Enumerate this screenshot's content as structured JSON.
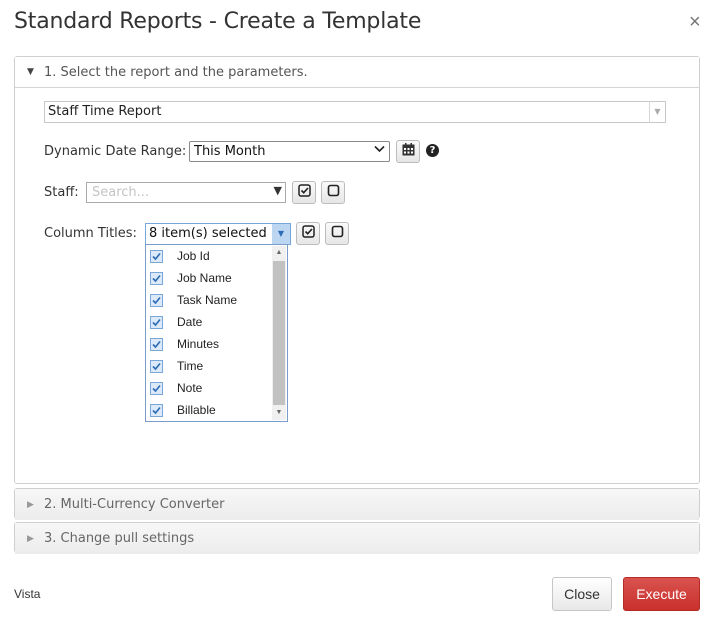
{
  "dialog": {
    "title": "Standard Reports - Create a Template",
    "close_glyph": "×"
  },
  "panels": [
    {
      "label": "1. Select the report and the parameters.",
      "expanded": true
    },
    {
      "label": "2. Multi-Currency Converter",
      "expanded": false
    },
    {
      "label": "3. Change pull settings",
      "expanded": false
    }
  ],
  "report": {
    "selected": "Staff Time Report"
  },
  "date_range": {
    "label": "Dynamic Date Range:",
    "selected": "This Month",
    "calendar_icon": "calendar-icon",
    "help_icon": "question-circle-icon"
  },
  "staff": {
    "label": "Staff:",
    "placeholder": "Search..."
  },
  "columns": {
    "label": "Column Titles:",
    "summary": "8 item(s) selected",
    "items": [
      {
        "label": "Job Id",
        "checked": true
      },
      {
        "label": "Job Name",
        "checked": true
      },
      {
        "label": "Task Name",
        "checked": true
      },
      {
        "label": "Date",
        "checked": true
      },
      {
        "label": "Minutes",
        "checked": true
      },
      {
        "label": "Time",
        "checked": true
      },
      {
        "label": "Note",
        "checked": true
      },
      {
        "label": "Billable",
        "checked": true
      }
    ]
  },
  "footer": {
    "theme_label": "Vista",
    "close_label": "Close",
    "execute_label": "Execute"
  },
  "colors": {
    "execute_bg": "#d43f3a",
    "selection_border": "#7aa7d9",
    "checkbox_fill": "#dbe9f8"
  }
}
